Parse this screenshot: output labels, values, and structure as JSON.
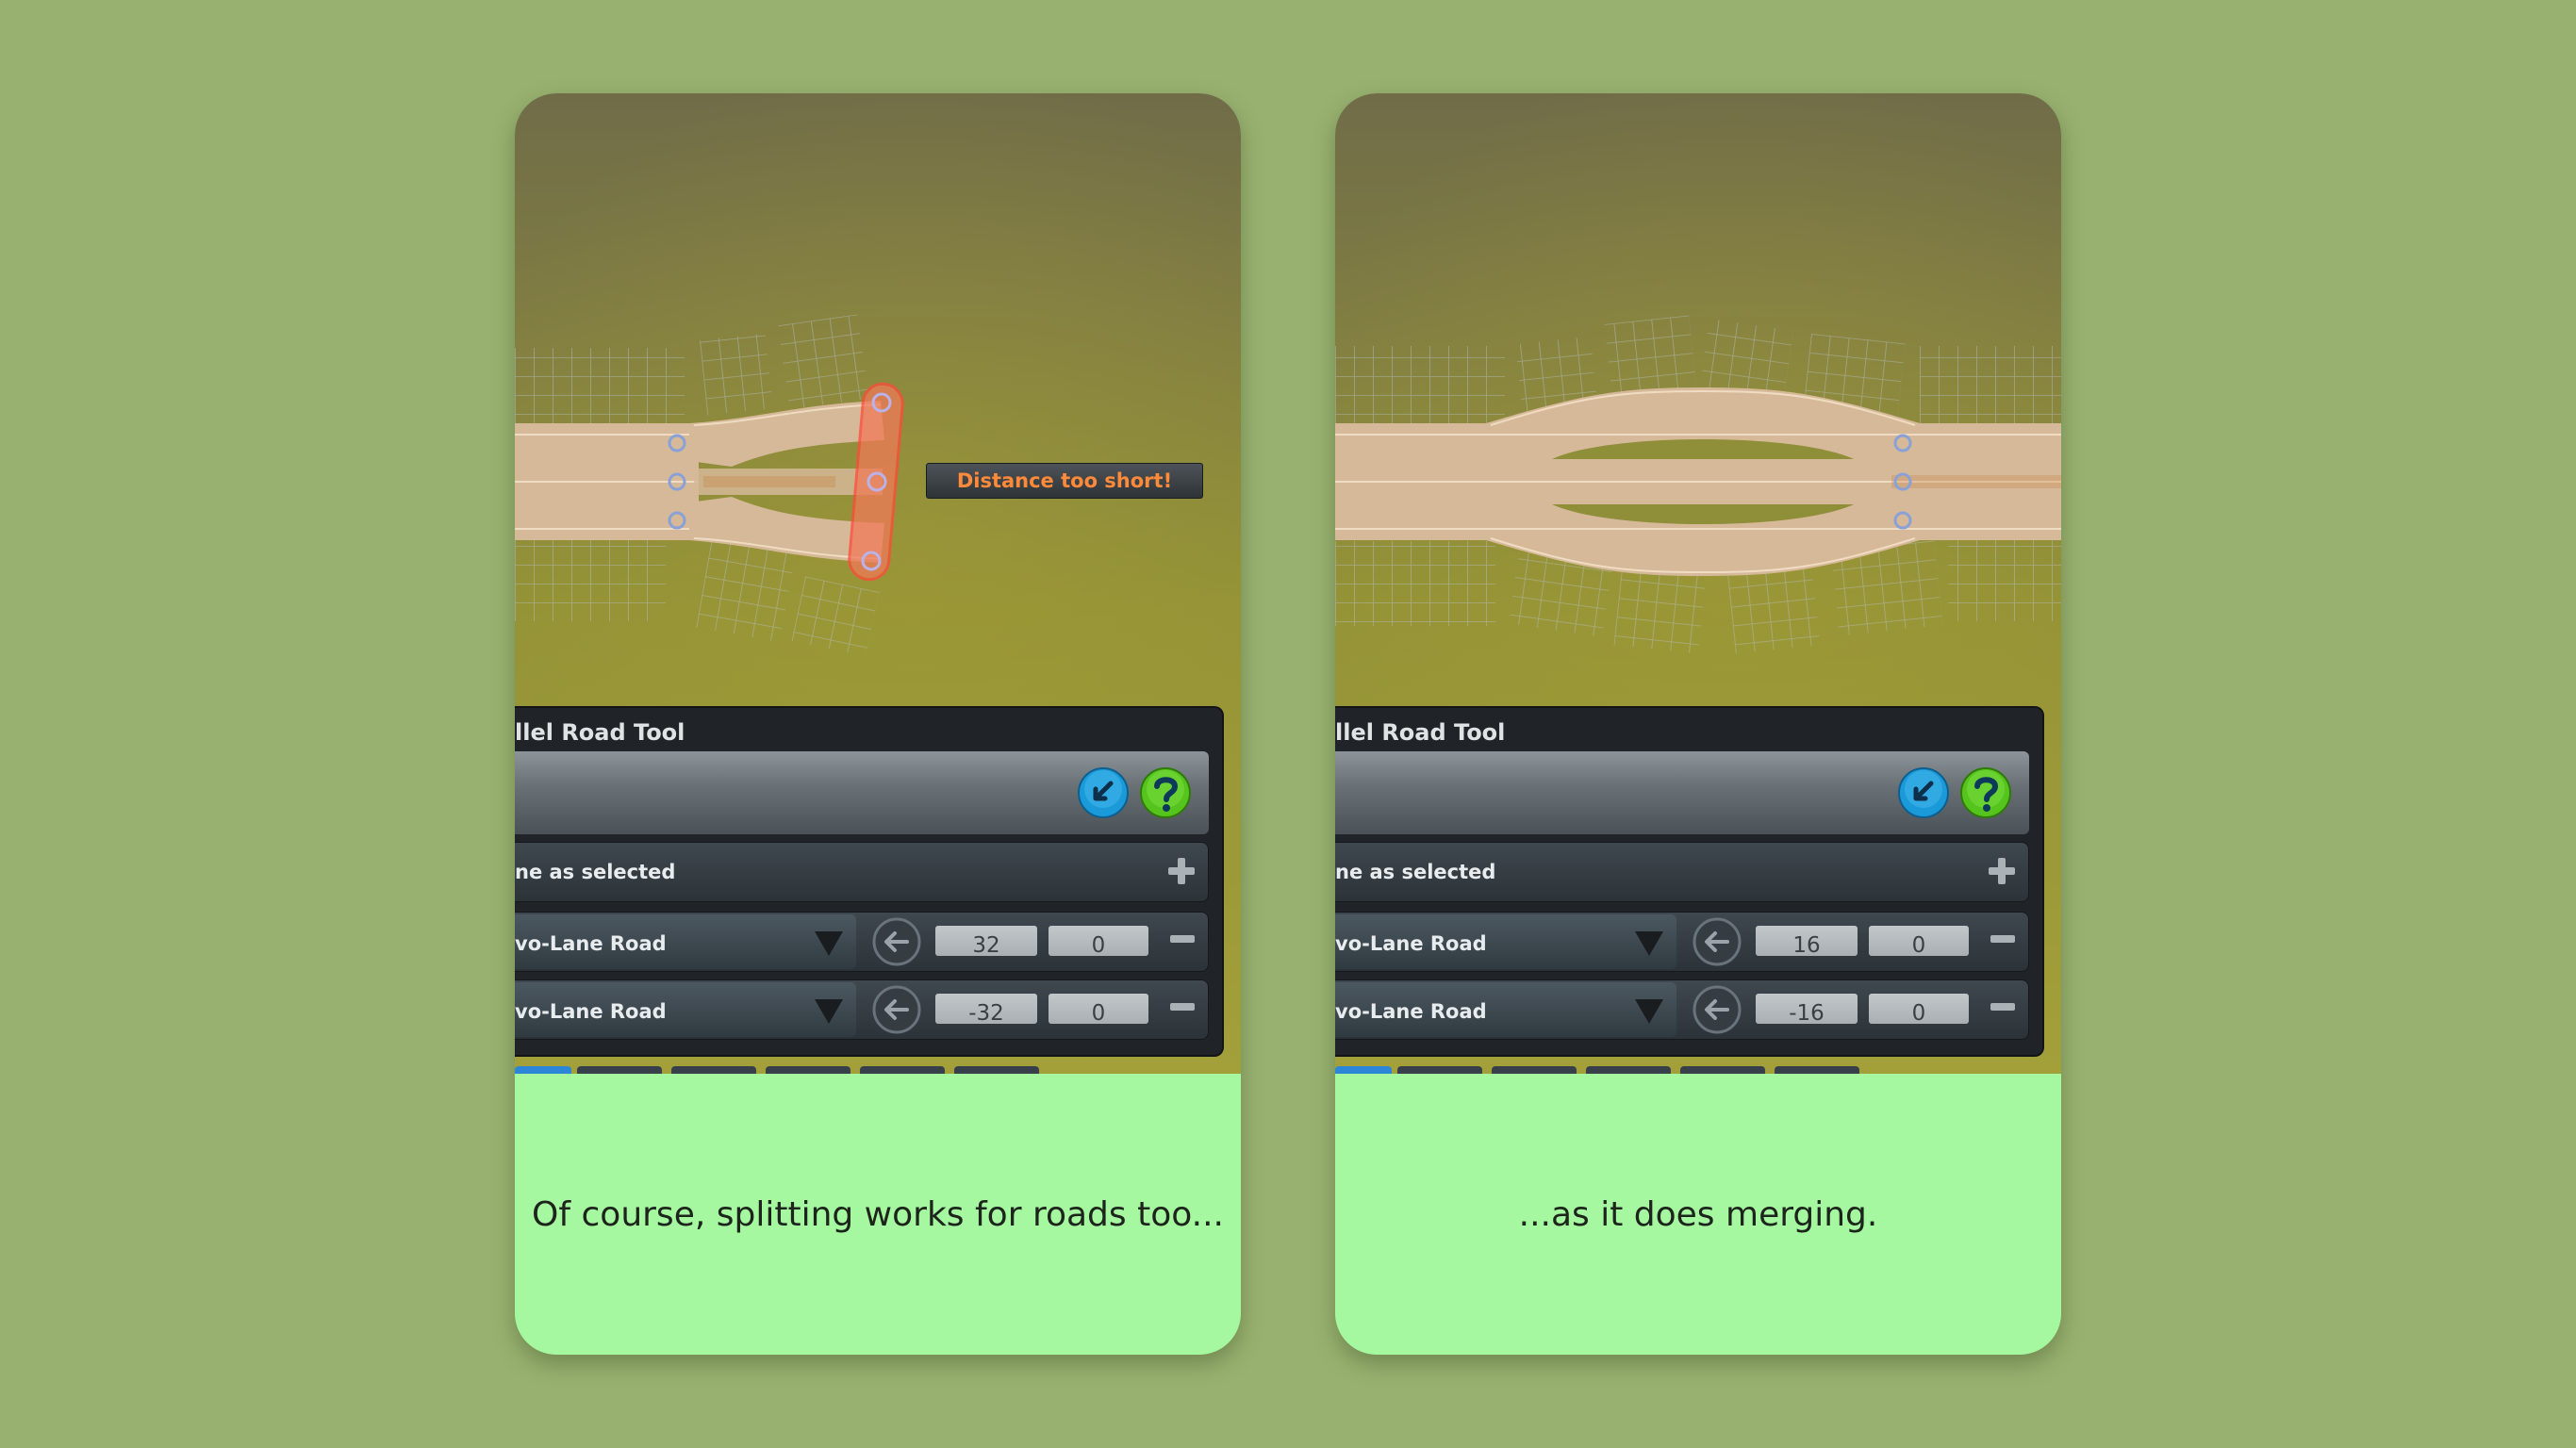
{
  "colors": {
    "page_background": "#99b170",
    "caption_background": "#a5f8a0",
    "warning_text": "#ff8a3a",
    "help_button": "#55c41c",
    "reverse_button": "#1a9ad8"
  },
  "panels": [
    {
      "title": "llel Road Tool",
      "row_same_label": "ne as selected",
      "roads": [
        {
          "label": "vo-Lane Road",
          "offset": "32",
          "height": "0"
        },
        {
          "label": "vo-Lane Road",
          "offset": "-32",
          "height": "0"
        }
      ],
      "warning": "Distance too short!",
      "caption": "Of course, splitting works for roads too..."
    },
    {
      "title": "llel Road Tool",
      "row_same_label": "ne as selected",
      "roads": [
        {
          "label": "vo-Lane Road",
          "offset": "16",
          "height": "0"
        },
        {
          "label": "vo-Lane Road",
          "offset": "-16",
          "height": "0"
        }
      ],
      "caption": "...as it does merging."
    }
  ],
  "icons": {
    "reverse": "reverse-direction-icon",
    "help": "question-mark-icon",
    "add": "plus-icon",
    "remove": "minus-icon",
    "back": "left-arrow-icon",
    "dropdown": "triangle-down-icon"
  }
}
